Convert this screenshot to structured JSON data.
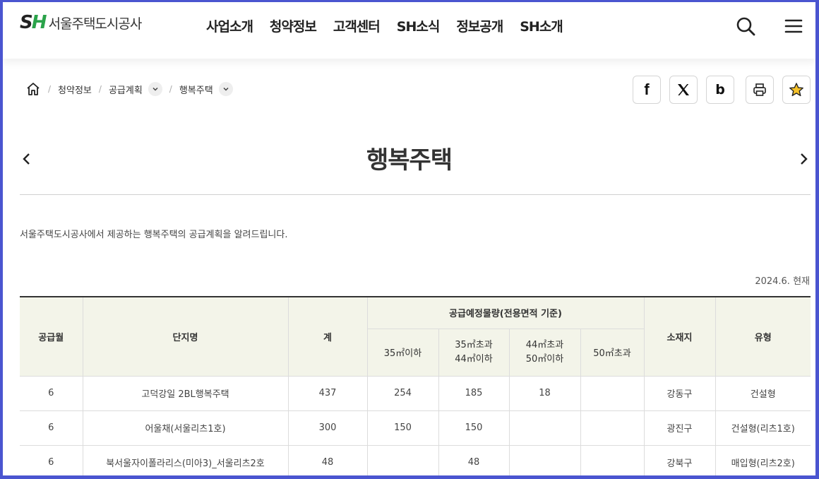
{
  "header": {
    "logo_mark_s": "S",
    "logo_mark_h": "H",
    "logo_text": "서울주택도시공사",
    "nav": [
      "사업소개",
      "청약정보",
      "고객센터",
      "SH소식",
      "정보공개",
      "SH소개"
    ],
    "icons": [
      "search-icon",
      "menu-icon"
    ]
  },
  "breadcrumb": {
    "items": [
      "청약정보",
      "공급계획",
      "행복주택"
    ]
  },
  "share_buttons": {
    "facebook": "f",
    "blog": "b"
  },
  "page": {
    "title": "행복주택",
    "description": "서울주택도시공사에서 제공하는 행복주택의 공급계획을 알려드립니다.",
    "date_label": "2024.6. 현재"
  },
  "table": {
    "headers": {
      "month": "공급월",
      "complex": "단지명",
      "total": "계",
      "group": "공급예정물량(전용면적 기준)",
      "sub1": "35㎡이하",
      "sub2_line1": "35㎡초과",
      "sub2_line2": "44㎡이하",
      "sub3_line1": "44㎡초과",
      "sub3_line2": "50㎡이하",
      "sub4": "50㎡초과",
      "location": "소재지",
      "type": "유형"
    },
    "rows": [
      {
        "month": "6",
        "complex": "고덕강일 2BL행복주택",
        "total": "437",
        "a": "254",
        "b": "185",
        "c": "18",
        "d": "",
        "location": "강동구",
        "type": "건설형"
      },
      {
        "month": "6",
        "complex": "어울채(서울리츠1호)",
        "total": "300",
        "a": "150",
        "b": "150",
        "c": "",
        "d": "",
        "location": "광진구",
        "type": "건설형(리츠1호)"
      },
      {
        "month": "6",
        "complex": "북서울자이폴라리스(미아3)_서울리츠2호",
        "total": "48",
        "a": "",
        "b": "48",
        "c": "",
        "d": "",
        "location": "강북구",
        "type": "매입형(리츠2호)"
      }
    ]
  }
}
